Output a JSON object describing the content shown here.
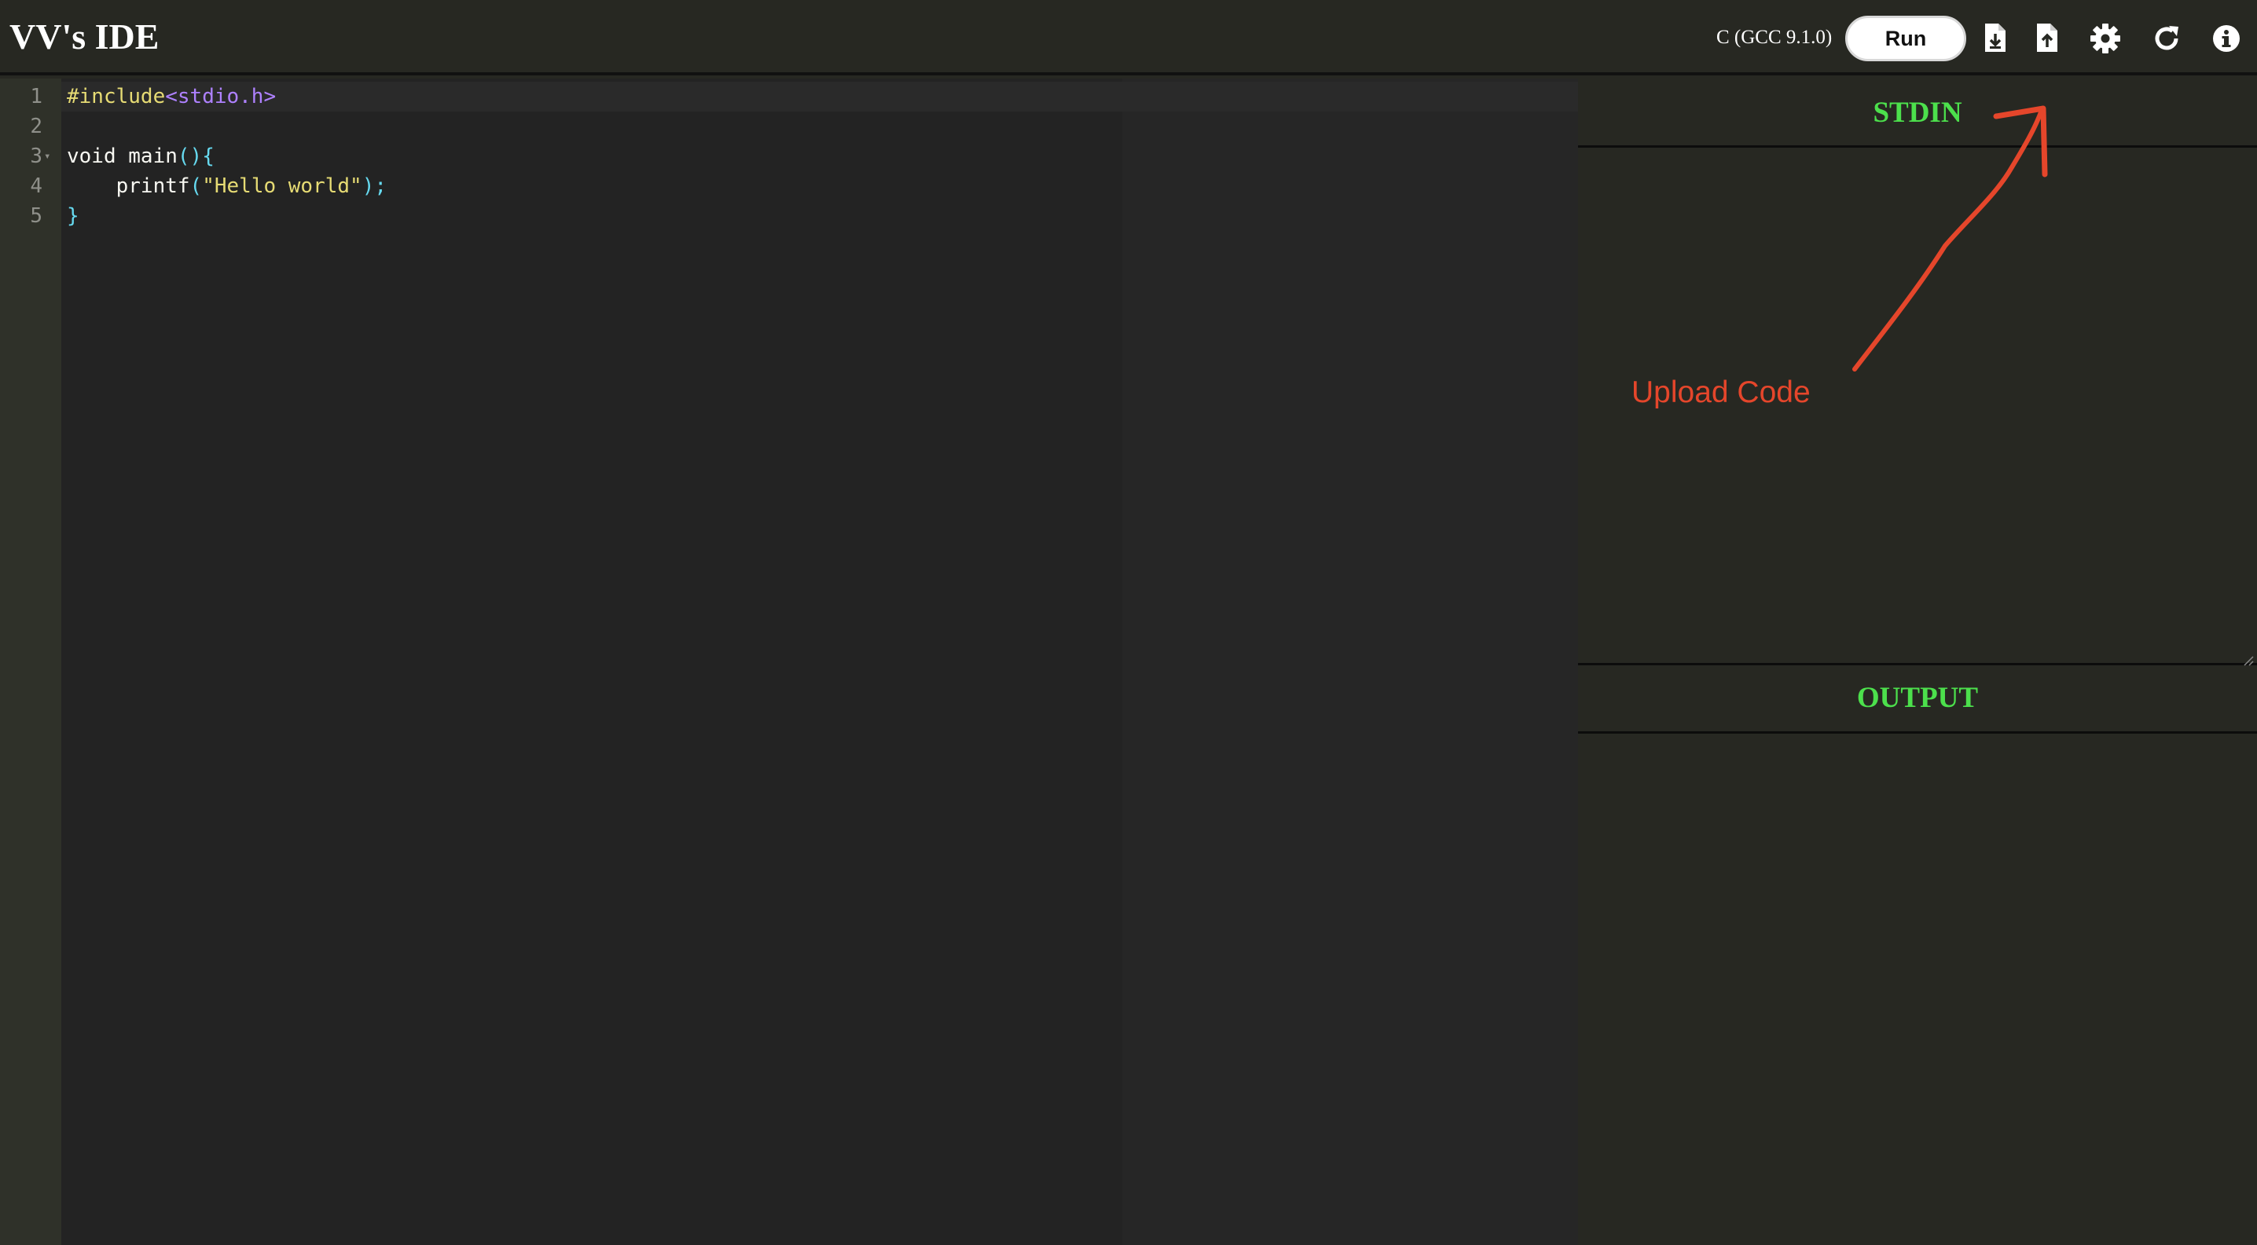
{
  "header": {
    "app_title": "VV's IDE",
    "language_label": "C (GCC 9.1.0)",
    "run_label": "Run",
    "icons": [
      "download-icon",
      "upload-icon",
      "gear-icon",
      "refresh-icon",
      "info-icon"
    ]
  },
  "editor": {
    "line_numbers": [
      "1",
      "2",
      "3",
      "4",
      "5"
    ],
    "lines": [
      {
        "preproc": "#include",
        "file": "<stdio.h>"
      },
      {
        "text": ""
      },
      {
        "keyword_main": "void main",
        "parens": "(){"
      },
      {
        "indent": "    ",
        "func": "printf",
        "open": "(",
        "string": "\"Hello world\"",
        "close": ");"
      },
      {
        "brace": "}"
      }
    ]
  },
  "stdin": {
    "title": "STDIN",
    "value": ""
  },
  "output": {
    "title": "OUTPUT",
    "value": ""
  },
  "annotation": {
    "text": "Upload Code",
    "color": "#e5462b"
  },
  "colors": {
    "background": "#272822",
    "editor_bg": "#232323",
    "panel_title": "#4ce04c",
    "accent_arrow": "#e5462b"
  }
}
